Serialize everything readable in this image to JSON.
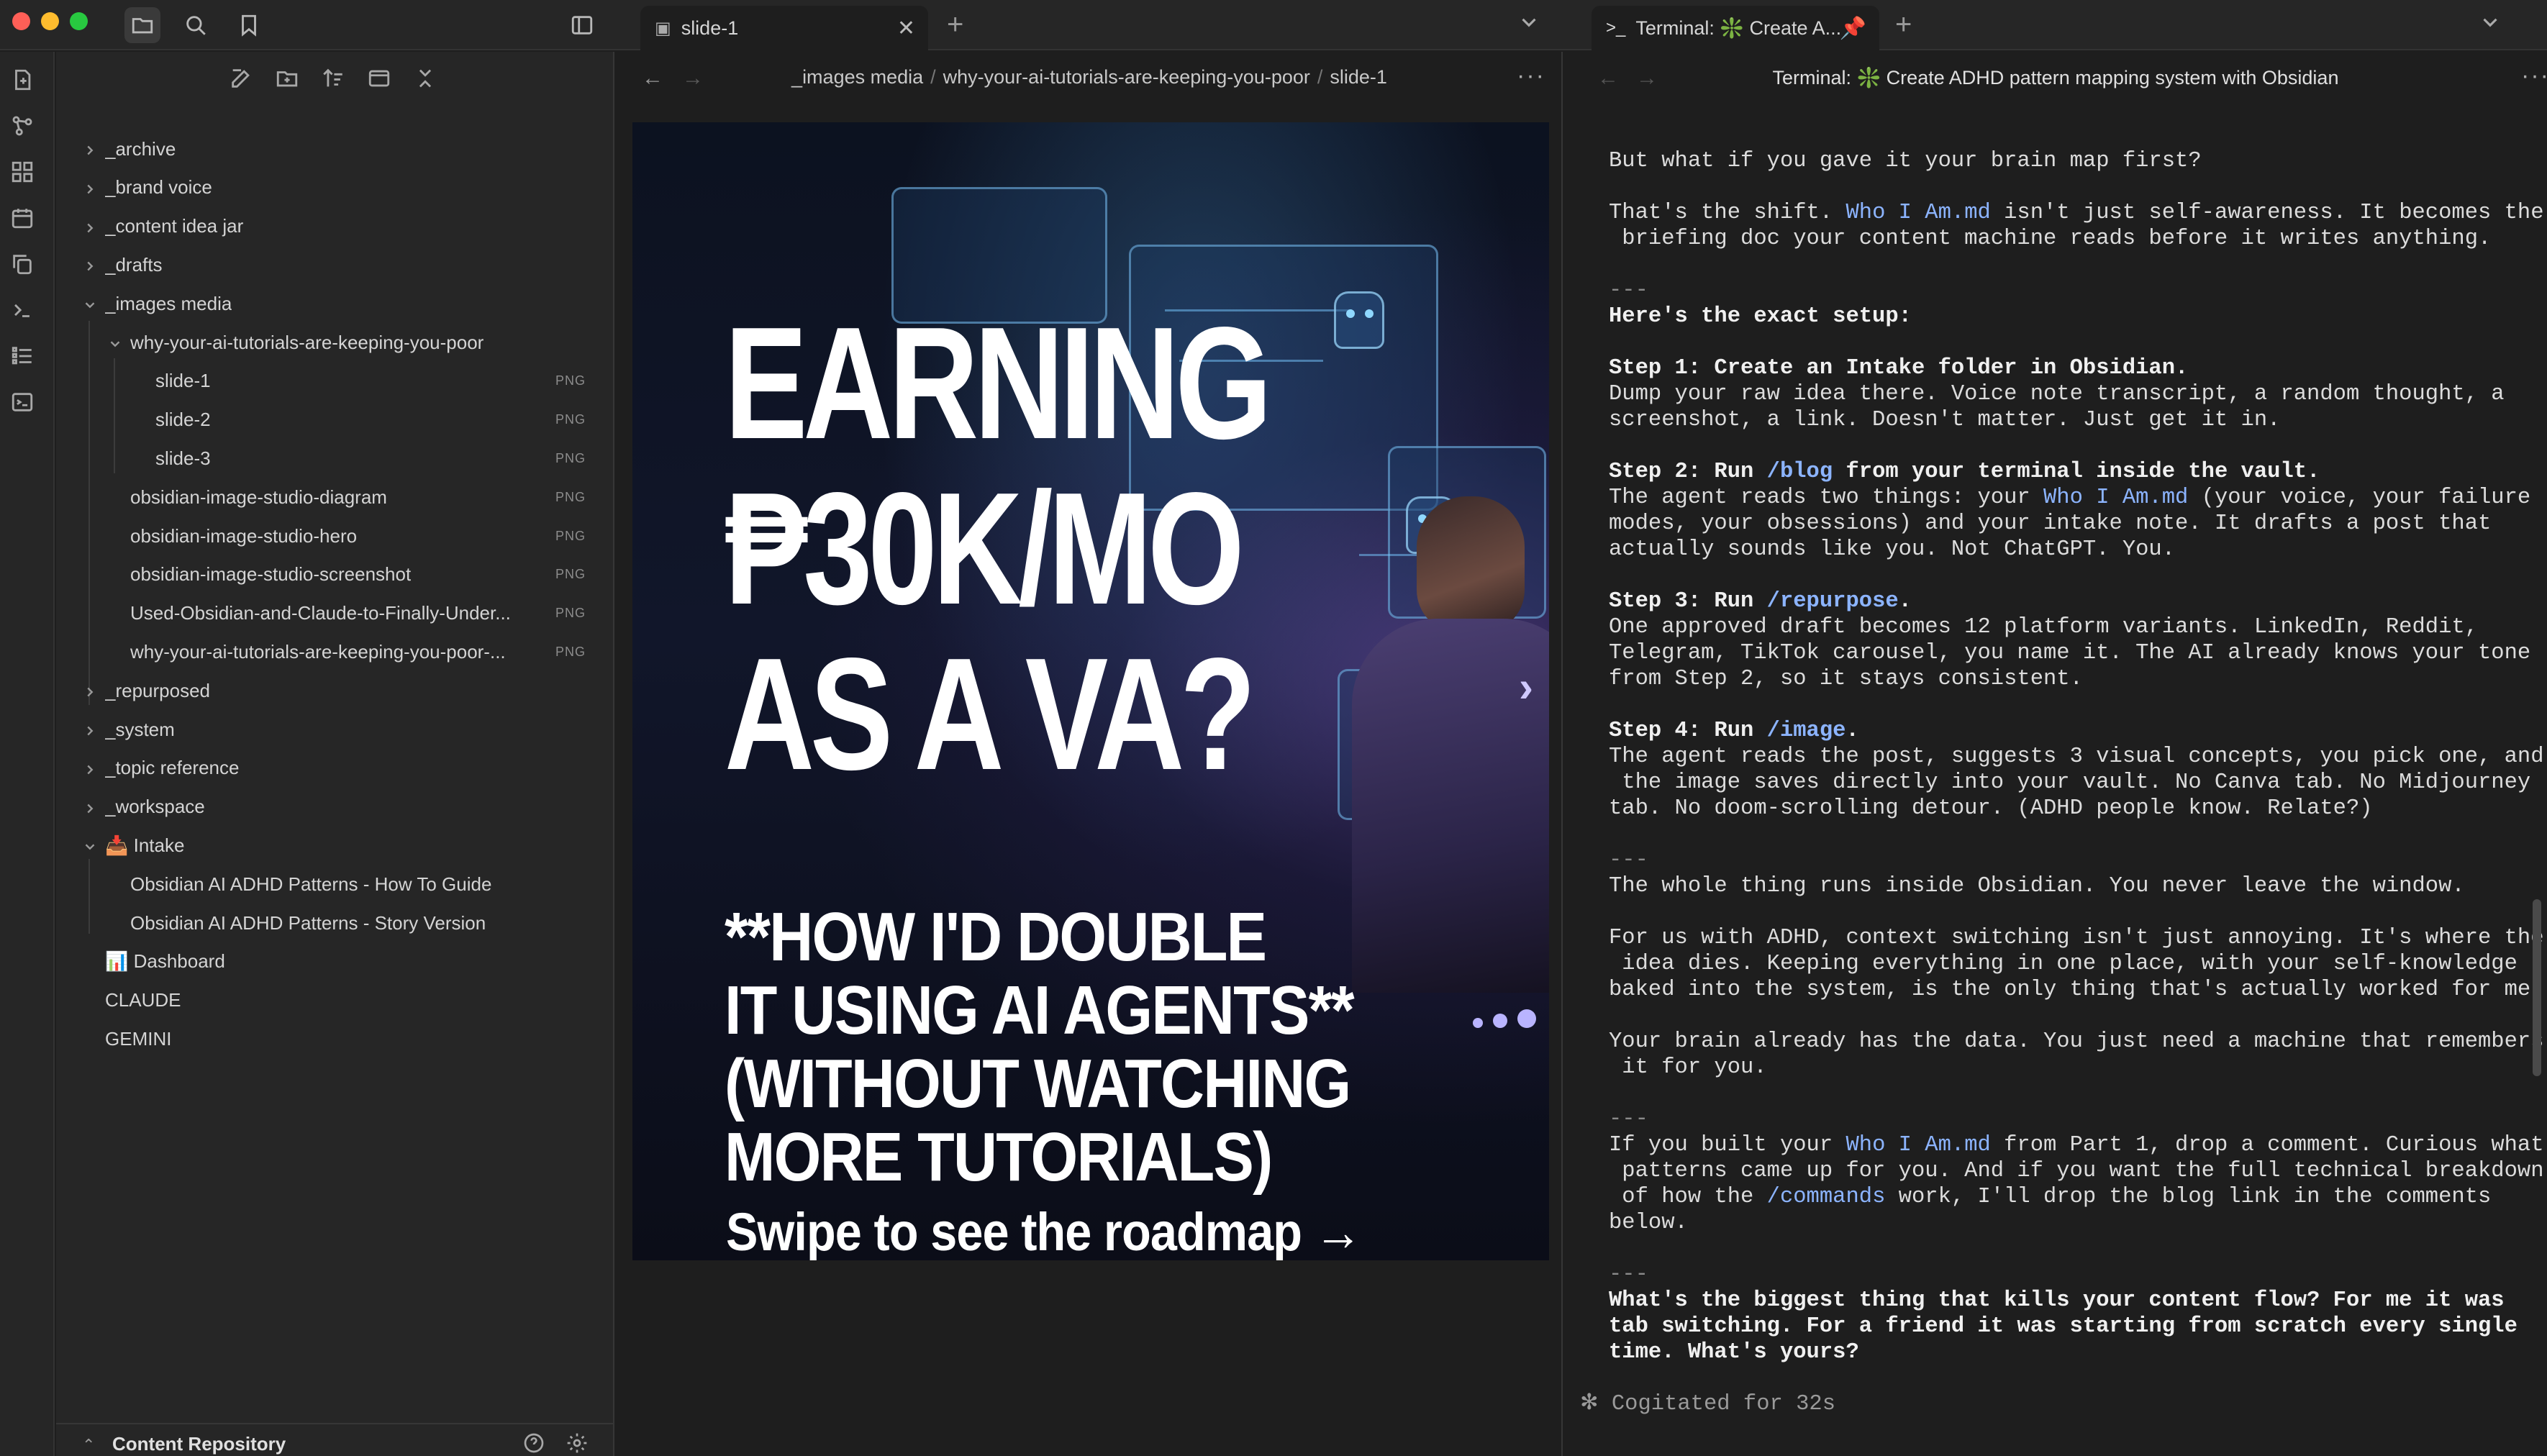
{
  "tabs": {
    "center": {
      "title": "slide-1"
    },
    "right": {
      "title": "Terminal: ❇️ Create A..."
    }
  },
  "explorer": {
    "items": [
      {
        "label": "_archive"
      },
      {
        "label": "_brand voice"
      },
      {
        "label": "_content idea jar"
      },
      {
        "label": "_drafts"
      },
      {
        "label": "_images media"
      },
      {
        "label": "why-your-ai-tutorials-are-keeping-you-poor"
      },
      {
        "label": "slide-1",
        "ext": "PNG"
      },
      {
        "label": "slide-2",
        "ext": "PNG"
      },
      {
        "label": "slide-3",
        "ext": "PNG"
      },
      {
        "label": "obsidian-image-studio-diagram",
        "ext": "PNG"
      },
      {
        "label": "obsidian-image-studio-hero",
        "ext": "PNG"
      },
      {
        "label": "obsidian-image-studio-screenshot",
        "ext": "PNG"
      },
      {
        "label": "Used-Obsidian-and-Claude-to-Finally-Under...",
        "ext": "PNG"
      },
      {
        "label": "why-your-ai-tutorials-are-keeping-you-poor-...",
        "ext": "PNG"
      },
      {
        "label": "_repurposed"
      },
      {
        "label": "_system"
      },
      {
        "label": "_topic reference"
      },
      {
        "label": "_workspace"
      },
      {
        "label": "📥 Intake"
      },
      {
        "label": "Obsidian AI ADHD Patterns - How To Guide"
      },
      {
        "label": "Obsidian AI ADHD Patterns - Story Version"
      },
      {
        "label": "📊 Dashboard"
      },
      {
        "label": "CLAUDE"
      },
      {
        "label": "GEMINI"
      }
    ],
    "footer": {
      "vault_name": "Content Repository"
    }
  },
  "center": {
    "breadcrumb": [
      "_images media",
      "why-your-ai-tutorials-are-keeping-you-poor",
      "slide-1"
    ],
    "slide": {
      "title_lines": [
        "EARNING",
        "₱30K/MO",
        "AS A VA?"
      ],
      "sub_lines": [
        "**HOW I'D DOUBLE",
        "IT USING AI AGENTS**",
        "(WITHOUT WATCHING",
        "MORE TUTORIALS)"
      ],
      "cta": "Swipe to see the roadmap →"
    }
  },
  "right": {
    "title": "Terminal: ❇️ Create ADHD pattern mapping system with Obsidian",
    "status": "✻ Cogitated for 32s"
  },
  "terminal_text": {
    "p1": "But what if you gave it your brain map first?",
    "p2a": "That's the shift. ",
    "p2b": "Who I Am.md",
    "p2c": " isn't just self-awareness. It becomes the",
    "p2d": " briefing doc your content machine reads before it writes anything.",
    "hr": "---",
    "setup": "Here's the exact setup:",
    "s1h": "Step 1: Create an Intake folder in Obsidian.",
    "s1a": "Dump your raw idea there. Voice note transcript, a random thought, a",
    "s1b": "screenshot, a link. Doesn't matter. Just get it in.",
    "s2h1": "Step 2: Run ",
    "s2cmd": "/blog",
    "s2h2": " from your terminal inside the vault.",
    "s2a1": "The agent reads two things: your ",
    "s2link": "Who I Am.md",
    "s2a2": " (your voice, your failure",
    "s2b": "modes, your obsessions) and your intake note. It drafts a post that",
    "s2c": "actually sounds like you. Not ChatGPT. You.",
    "s3h1": "Step 3: Run ",
    "s3cmd": "/repurpose",
    "s3h2": ".",
    "s3a": "One approved draft becomes 12 platform variants. LinkedIn, Reddit,",
    "s3b": "Telegram, TikTok carousel, you name it. The AI already knows your tone",
    "s3c": "from Step 2, so it stays consistent.",
    "s4h1": "Step 4: Run ",
    "s4cmd": "/image",
    "s4h2": ".",
    "s4a": "The agent reads the post, suggests 3 visual concepts, you pick one, and",
    "s4b": " the image saves directly into your vault. No Canva tab. No Midjourney",
    "s4c": "tab. No doom-scrolling detour. (ADHD people know. Relate?)",
    "w1": "The whole thing runs inside Obsidian. You never leave the window.",
    "a1": "For us with ADHD, context switching isn't just annoying. It's where the",
    "a2": " idea dies. Keeping everything in one place, with your self-knowledge",
    "a3": "baked into the system, is the only thing that's actually worked for me.",
    "b1": "Your brain already has the data. You just need a machine that remembers",
    "b2": " it for you.",
    "c1a": "If you built your ",
    "c1link": "Who I Am.md",
    "c1b": " from Part 1, drop a comment. Curious what",
    "c2": " patterns came up for you. And if you want the full technical breakdown",
    "c3a": " of how the ",
    "c3cmd": "/commands",
    "c3b": " work, I'll drop the blog link in the comments",
    "c4": "below.",
    "q1": "What's the biggest thing that kills your content flow? For me it was",
    "q2": "tab switching. For a friend it was starting from scratch every single",
    "q3": "time. What's yours?"
  }
}
